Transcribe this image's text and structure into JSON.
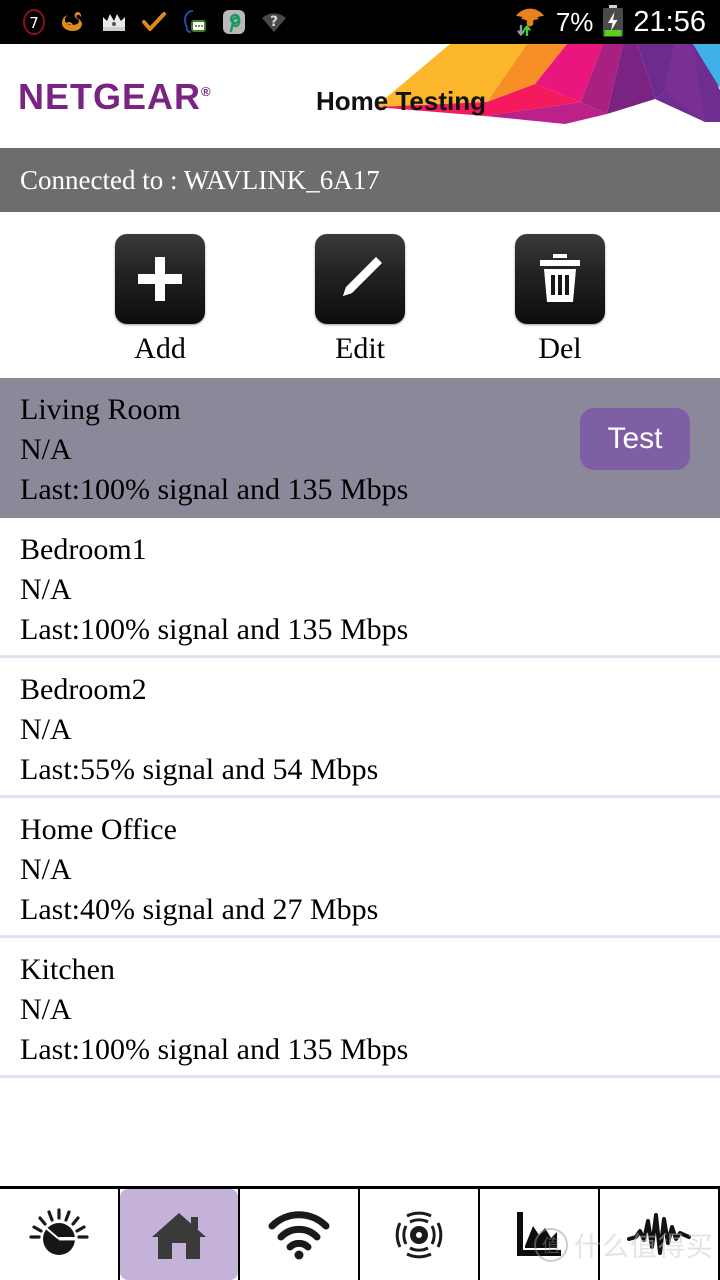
{
  "statusbar": {
    "left_icons": [
      {
        "name": "notification-count-icon",
        "label": "7"
      },
      {
        "name": "uc-browser-icon",
        "label": ""
      },
      {
        "name": "clash-royale-icon",
        "label": ""
      },
      {
        "name": "checkmark-icon",
        "label": ""
      },
      {
        "name": "messaging-icon",
        "label": ""
      },
      {
        "name": "pinterest-icon",
        "label": "P"
      },
      {
        "name": "unknown-wifi-icon",
        "label": "?"
      }
    ],
    "wifi_icon": "wifi-data-transfer-icon",
    "battery_percent": "7%",
    "battery_icon": "battery-charging-icon",
    "clock": "21:56"
  },
  "header": {
    "brand": "NETGEAR",
    "brand_mark": "®",
    "brand_color": "#7a2382",
    "title": "Home Testing",
    "graphic": "netgear-polygon-graphic"
  },
  "connection": {
    "label": "Connected to : WAVLINK_6A17"
  },
  "actions": [
    {
      "label": "Add",
      "icon": "plus-icon",
      "name": "add-button"
    },
    {
      "label": "Edit",
      "icon": "pencil-icon",
      "name": "edit-button"
    },
    {
      "label": "Del",
      "icon": "trash-icon",
      "name": "delete-button"
    }
  ],
  "list": {
    "test_button_label": "Test",
    "selected_index": 0,
    "items": [
      {
        "name": "Living Room",
        "status": "N/A",
        "last": "Last:100% signal and 135 Mbps"
      },
      {
        "name": "Bedroom1",
        "status": "N/A",
        "last": "Last:100% signal and 135 Mbps"
      },
      {
        "name": "Bedroom2",
        "status": "N/A",
        "last": "Last:55% signal and 54 Mbps"
      },
      {
        "name": "Home Office",
        "status": "N/A",
        "last": "Last:40% signal and 27 Mbps"
      },
      {
        "name": "Kitchen",
        "status": "N/A",
        "last": "Last:100% signal and 135 Mbps"
      }
    ]
  },
  "navbar": {
    "active_index": 1,
    "items": [
      {
        "icon": "speedometer-icon",
        "name": "nav-speed-test"
      },
      {
        "icon": "home-icon",
        "name": "nav-home-testing"
      },
      {
        "icon": "wifi-icon",
        "name": "nav-wifi-analytics"
      },
      {
        "icon": "signal-strength-icon",
        "name": "nav-signal-strength"
      },
      {
        "icon": "chart-icon",
        "name": "nav-channel-graph"
      },
      {
        "icon": "waveform-icon",
        "name": "nav-interference"
      }
    ]
  },
  "watermark": {
    "logo": "值",
    "text": "什么值得买"
  },
  "colors": {
    "selected_row": "#8b8899",
    "test_button": "#7e5fa6",
    "nav_active": "#c4b2d9",
    "divider": "#e2e1f2",
    "connbar": "#6d6d6d"
  }
}
